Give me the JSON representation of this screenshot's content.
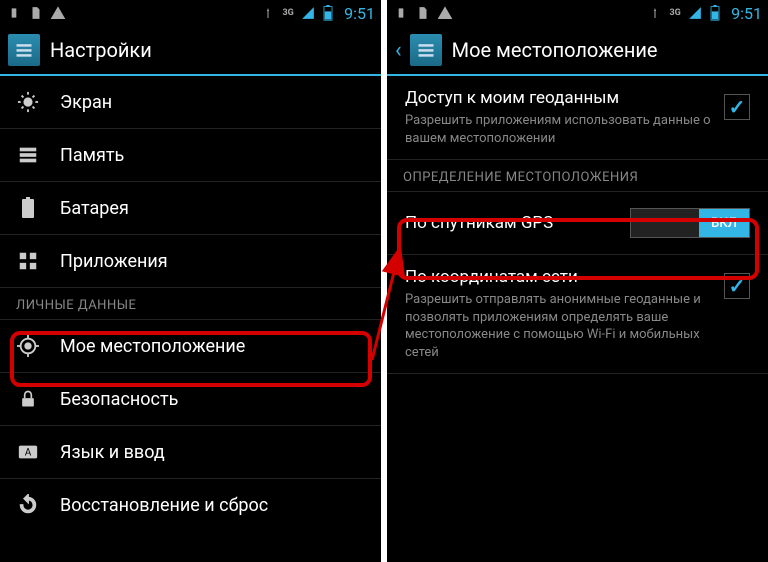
{
  "status": {
    "time": "9:51",
    "icons_left": [
      "usb-icon",
      "sim-icon",
      "warning-icon"
    ],
    "icons_right": [
      "antenna-icon",
      "threeg-icon",
      "signal-icon",
      "battery-icon"
    ]
  },
  "left": {
    "title": "Настройки",
    "items": [
      {
        "icon": "display-icon",
        "label": "Экран"
      },
      {
        "icon": "storage-icon",
        "label": "Память"
      },
      {
        "icon": "battery-icon",
        "label": "Батарея"
      },
      {
        "icon": "apps-icon",
        "label": "Приложения"
      }
    ],
    "section": "ЛИЧНЫЕ ДАННЫЕ",
    "items2": [
      {
        "icon": "location-icon",
        "label": "Мое местоположение"
      },
      {
        "icon": "lock-icon",
        "label": "Безопасность"
      },
      {
        "icon": "language-icon",
        "label": "Язык и ввод"
      },
      {
        "icon": "backup-icon",
        "label": "Восстановление и сброс"
      }
    ]
  },
  "right": {
    "title": "Мое местоположение",
    "geo": {
      "title": "Доступ к моим геоданным",
      "desc": "Разрешить приложениям использовать данные о вашем местоположении",
      "checked": true
    },
    "section": "ОПРЕДЕЛЕНИЕ МЕСТОПОЛОЖЕНИЯ",
    "gps": {
      "label": "По спутникам GPS",
      "toggle_on": "ВКЛ"
    },
    "net": {
      "title": "По координатам сети",
      "desc": "Разрешить отправлять анонимные геоданные и позволять приложениям определять ваше местоположение с помощью Wi-Fi и мобильных сетей",
      "checked": true
    }
  }
}
